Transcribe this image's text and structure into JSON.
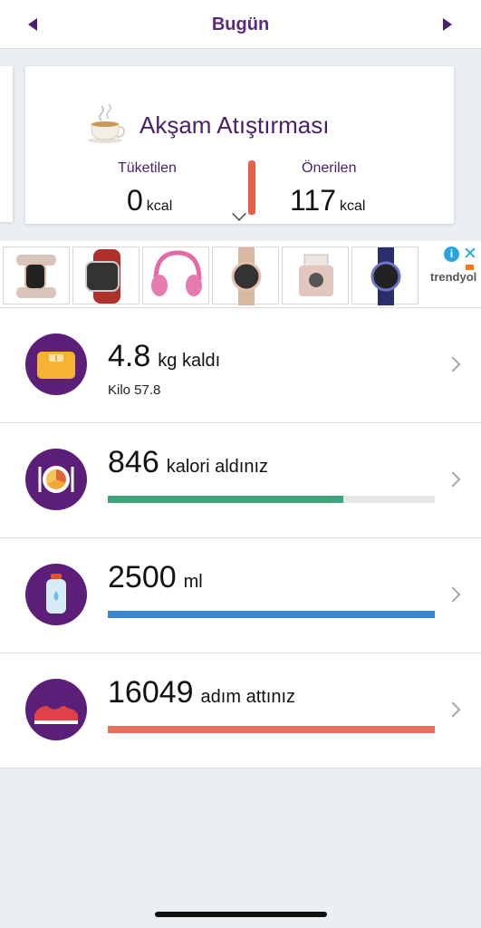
{
  "nav": {
    "title": "Bugün",
    "prev_icon": "triangle-left-icon",
    "next_icon": "triangle-right-icon",
    "color": "#5b2a7e"
  },
  "meal": {
    "title": "Akşam Atıştırması",
    "icon": "teacup-icon",
    "consumed_label": "Tüketilen",
    "consumed_value": "0",
    "consumed_unit": "kcal",
    "suggested_label": "Önerilen",
    "suggested_value": "117",
    "suggested_unit": "kcal",
    "bar_color": "#e8604c"
  },
  "ad": {
    "info_icon": "info-icon",
    "close_icon": "close-icon",
    "brand": "trendyol",
    "items": [
      "smartwatch-rose-gold",
      "smartwatch-red-band",
      "kids-headphones",
      "smartwatch-mesh-gold",
      "instant-camera",
      "smartwatch-blue"
    ]
  },
  "rows": [
    {
      "icon": "scale-icon",
      "value": "4.8",
      "unit": "kg kaldı",
      "sub": "Kilo 57.8"
    },
    {
      "icon": "plate-icon",
      "value": "846",
      "unit": "kalori aldınız",
      "progress": 0.72,
      "color": "#3ea57a"
    },
    {
      "icon": "water-bottle-icon",
      "value": "2500",
      "unit": "ml",
      "progress": 1.0,
      "color": "#3b87cf"
    },
    {
      "icon": "sneaker-icon",
      "value": "16049",
      "unit": "adım attınız",
      "progress": 1.0,
      "color": "#e4705d"
    }
  ]
}
